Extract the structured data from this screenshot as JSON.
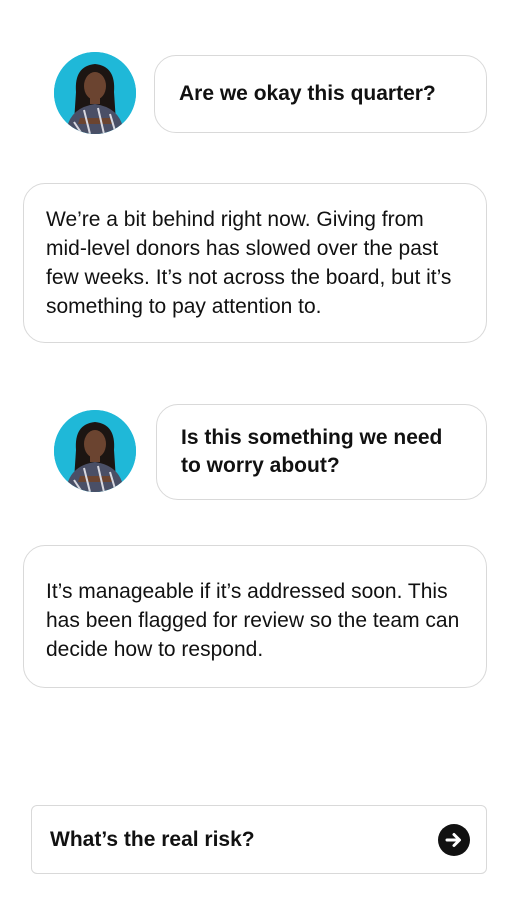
{
  "conversation": [
    {
      "role": "user",
      "text": "Are we okay this quarter?"
    },
    {
      "role": "assistant",
      "text": "We’re a bit behind right now. Giving from mid-level donors has slowed over the past few weeks. It’s not across the board, but it’s something to pay attention to."
    },
    {
      "role": "user",
      "text": "Is this something we need to worry about?"
    },
    {
      "role": "assistant",
      "text": "It’s manageable if it’s addressed soon. This has been flagged for review so the team can decide how to respond."
    }
  ],
  "suggestion": {
    "text": "What’s the real risk?",
    "send_icon": "arrow-right-circle-icon"
  },
  "colors": {
    "avatar_bg": "#1fb8d8",
    "bubble_border": "#d9d9d9",
    "text": "#111111"
  }
}
